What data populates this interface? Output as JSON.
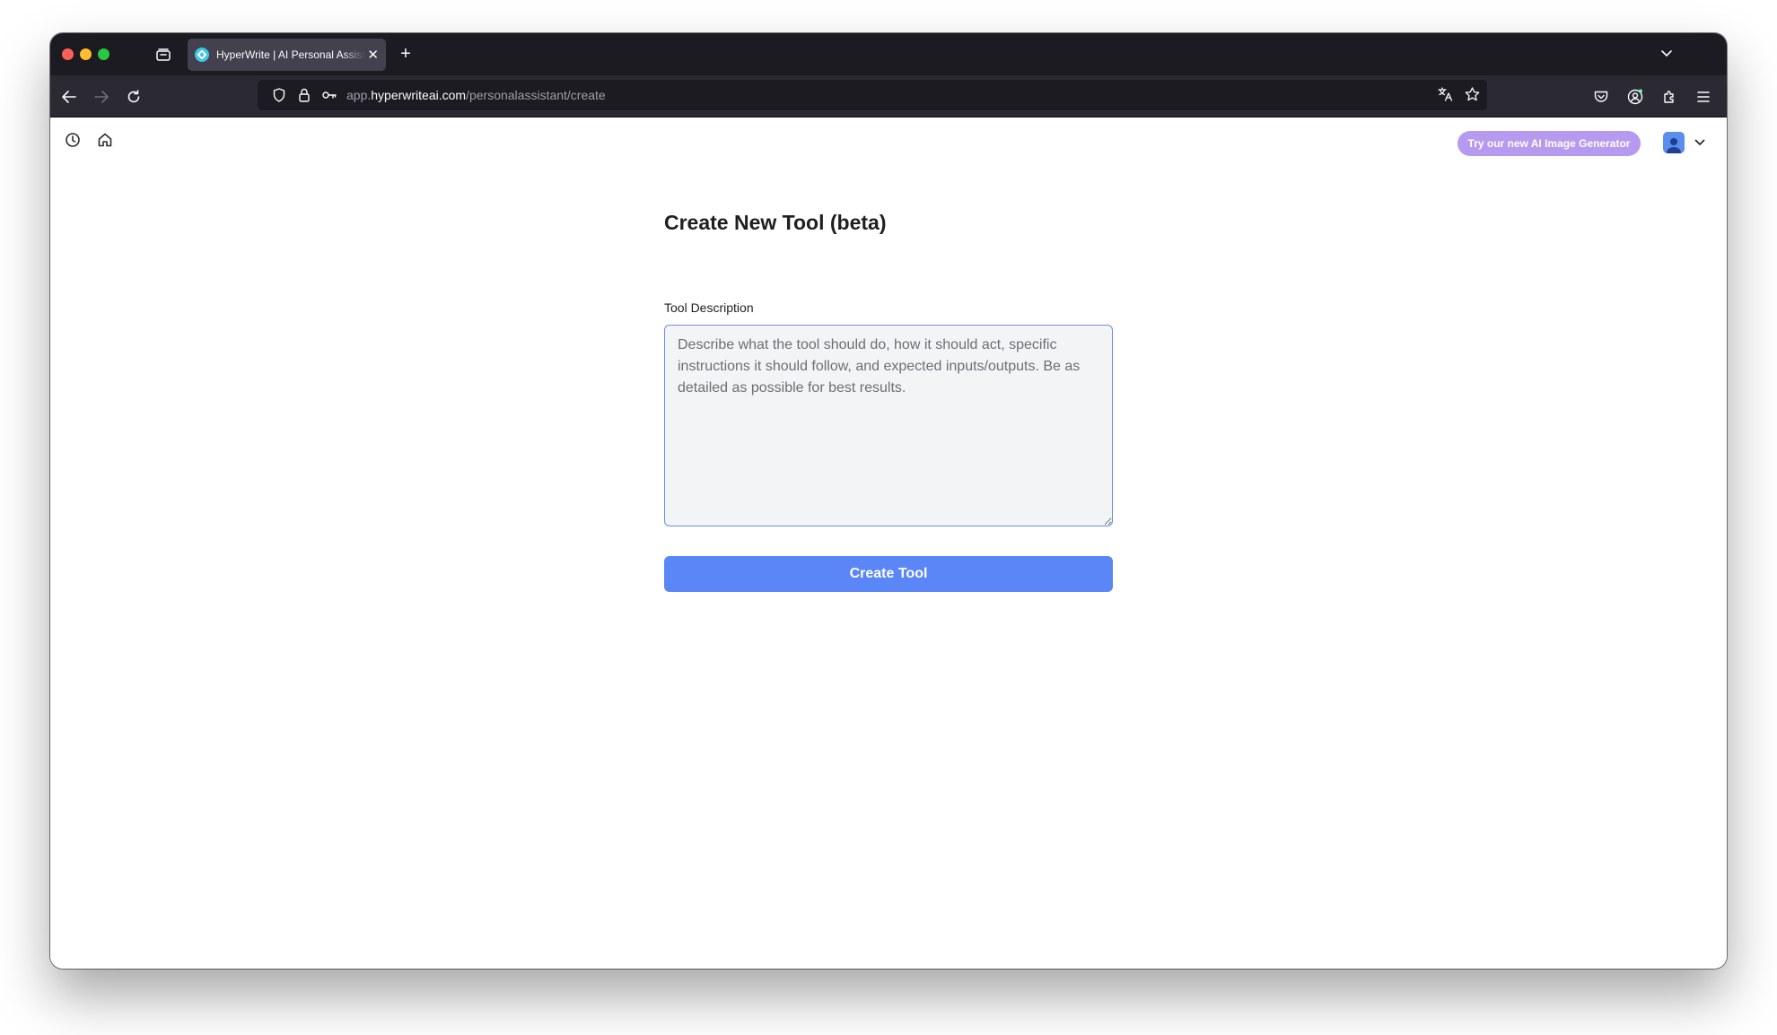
{
  "browser": {
    "tab": {
      "title": "HyperWrite | AI Personal Assistant",
      "favicon": "hyperwrite-logo-icon"
    },
    "url": {
      "prefix": "app.",
      "domain": "hyperwriteai.com",
      "path": "/personalassistant/create"
    },
    "icons": [
      "back-arrow-icon",
      "forward-arrow-icon",
      "reload-icon",
      "shield-icon",
      "lock-icon",
      "key-icon",
      "translate-icon",
      "bookmark-star-icon",
      "pocket-icon",
      "account-icon",
      "extensions-icon",
      "menu-icon",
      "tab-manager-icon",
      "new-tab-plus-icon",
      "tab-list-chevron-icon"
    ]
  },
  "header": {
    "promo_label": "Try our new AI Image Generator",
    "icons": [
      "history-clock-icon",
      "home-icon",
      "avatar",
      "chevron-down-icon"
    ]
  },
  "form": {
    "title": "Create New Tool (beta)",
    "description_label": "Tool Description",
    "description_value": "",
    "description_placeholder": "Describe what the tool should do, how it should act, specific instructions it should follow, and expected inputs/outputs. Be as detailed as possible for best results.",
    "submit_label": "Create Tool"
  },
  "colors": {
    "promo_bg": "#b69aef",
    "button_bg": "#5a86f8",
    "textarea_bg": "#f3f4f6",
    "textarea_border": "#6b8fe0",
    "browser_chrome": "#1c1b22",
    "navbar": "#2b2a33"
  }
}
